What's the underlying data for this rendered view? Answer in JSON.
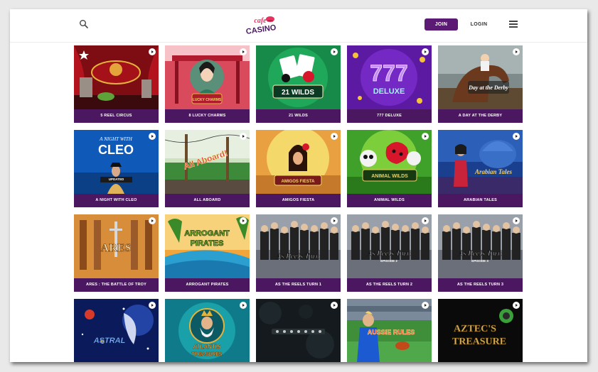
{
  "brand": {
    "line1": "cafe",
    "line2": "CASINO"
  },
  "header": {
    "join_label": "JOIN",
    "login_label": "LOGIN"
  },
  "games": [
    {
      "label": "5 Reel Circus"
    },
    {
      "label": "8 Lucky Charms",
      "art_text": "LUCKY CHARMS"
    },
    {
      "label": "21 Wilds",
      "art_text": "21 WILDS"
    },
    {
      "label": "777 Deluxe",
      "art_text": "777",
      "art_text2": "DELUXE"
    },
    {
      "label": "A Day at the Derby",
      "art_text": "Day at the Derby"
    },
    {
      "label": "A Night With Cleo",
      "art_text": "A NIGHT WITH",
      "art_text2": "CLEO",
      "badge": "UPDATED"
    },
    {
      "label": "All Aboard",
      "art_text": "All Aboard!"
    },
    {
      "label": "Amigos Fiesta",
      "art_text": "AMIGOS FIESTA"
    },
    {
      "label": "Animal Wilds",
      "art_text": "ANIMAL WILDS"
    },
    {
      "label": "Arabian Tales",
      "art_text": "Arabian Tales"
    },
    {
      "label": "Ares : The Battle of Troy",
      "art_text": "ARES"
    },
    {
      "label": "Arrogant Pirates",
      "art_text": "ARROGANT",
      "art_text2": "PIRATES"
    },
    {
      "label": "As The Reels Turn 1",
      "art_text": "As Reels Turn"
    },
    {
      "label": "As The Reels Turn 2",
      "art_text": "As Reels Turn",
      "art_text2": "EPISODE 2"
    },
    {
      "label": "As The Reels Turn 3",
      "art_text": "As Reels Turn",
      "art_text2": "EPISODE 3"
    },
    {
      "label": "",
      "art_text": "ASTRAL"
    },
    {
      "label": "",
      "art_text": "ATLANTIS",
      "art_text2": "TREASURES"
    },
    {
      "label": ""
    },
    {
      "label": "",
      "art_text": "AUSSIE RULES"
    },
    {
      "label": "",
      "art_text": "AZTEC'S",
      "art_text2": "TREASURE"
    }
  ]
}
